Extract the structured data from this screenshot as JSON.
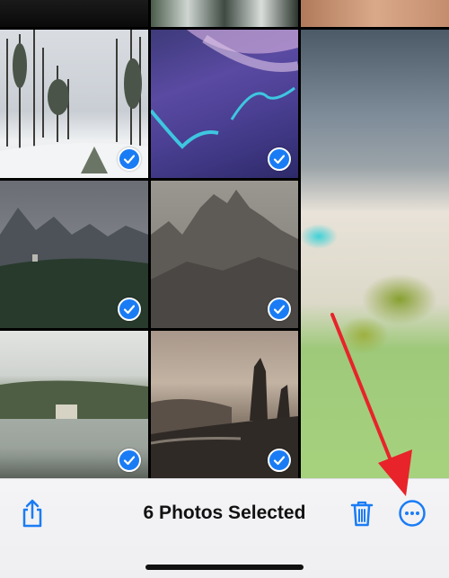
{
  "toolbar": {
    "title": "6 Photos Selected",
    "icons": {
      "share": "share-icon",
      "delete": "trash-icon",
      "more": "ellipsis-circle-icon"
    }
  },
  "photos": [
    {
      "description": "snowy pine forest",
      "selected": true
    },
    {
      "description": "purple aurora abstract",
      "selected": true
    },
    {
      "description": "misty mountains over forest",
      "selected": true
    },
    {
      "description": "rocky mountain peaks",
      "selected": true
    },
    {
      "description": "lake with castle in fog",
      "selected": true
    },
    {
      "description": "rock pinnacles at sunset over sea",
      "selected": true
    }
  ],
  "annotation": {
    "type": "red-arrow",
    "points_to": "more-button"
  },
  "colors": {
    "accent": "#1a7cf5",
    "arrow": "#e8232a"
  }
}
